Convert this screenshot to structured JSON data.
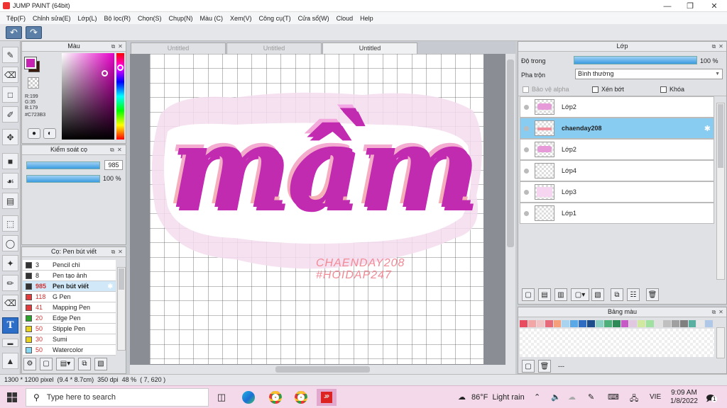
{
  "window": {
    "title": "JUMP PAINT (64bit)",
    "controls": [
      "minimize-icon",
      "maximize-icon",
      "close-icon"
    ]
  },
  "menu": [
    "Tệp(F)",
    "Chỉnh sửa(E)",
    "Lớp(L)",
    "Bộ lọc(R)",
    "Chọn(S)",
    "Chụp(N)",
    "Màu (C)",
    "Xem(V)",
    "Công cụ(T)",
    "Cửa sổ(W)",
    "Cloud",
    "Help"
  ],
  "color_panel": {
    "title": "Màu",
    "r": "R:199",
    "g": "G:35",
    "b": "B:179",
    "hex": "#C723B3",
    "foreground": "#c723b3",
    "background": "#3a1a0a"
  },
  "brush_control": {
    "title": "Kiểm soát cọ",
    "size": "985",
    "opacity": "100 %"
  },
  "brush_list": {
    "title": "Cọ: Pen bút viết",
    "items": [
      {
        "size": "3",
        "name": "Pencil chì",
        "color": "#333333"
      },
      {
        "size": "8",
        "name": "Pen tạo ảnh",
        "color": "#333333"
      },
      {
        "size": "985",
        "name": "Pen bút viết",
        "color": "#333333",
        "selected": true
      },
      {
        "size": "118",
        "name": "G Pen",
        "color": "#e23b3b"
      },
      {
        "size": "41",
        "name": "Mapping Pen",
        "color": "#e23b3b"
      },
      {
        "size": "20",
        "name": "Edge Pen",
        "color": "#2aa52a"
      },
      {
        "size": "50",
        "name": "Stipple Pen",
        "color": "#e8d21c"
      },
      {
        "size": "30",
        "name": "Sumi",
        "color": "#e8d21c"
      },
      {
        "size": "50",
        "name": "Watercolor",
        "color": "#86d8f2"
      }
    ]
  },
  "tabs": [
    "Untitled",
    "Untitled",
    "Untitled"
  ],
  "canvas": {
    "headline": "mầm",
    "watermark_line1": "CHAENDAY208",
    "watermark_line2": "#HOIDAP247"
  },
  "layer_panel": {
    "title": "Lớp",
    "opacity_label": "Độ trong",
    "opacity_value": "100 %",
    "blend_label": "Pha trộn",
    "blend_value": "Bình thường",
    "protect_alpha": "Bảo vệ alpha",
    "clipping": "Xén bớt",
    "lock": "Khóa",
    "layers": [
      {
        "name": "Lớp2",
        "selected": false
      },
      {
        "name": "chaenday208",
        "selected": true
      },
      {
        "name": "Lớp2",
        "selected": false
      },
      {
        "name": "Lớp4",
        "selected": false
      },
      {
        "name": "Lớp3",
        "selected": false
      },
      {
        "name": "Lớp1",
        "selected": false
      }
    ]
  },
  "palette_panel": {
    "title": "Bảng màu",
    "dashes": "---",
    "swatches": [
      "#e84a5f",
      "#f2a6a6",
      "#f0c4c4",
      "#e66a7a",
      "#f5a07a",
      "#a8d4f0",
      "#5aa9e6",
      "#2d6cc0",
      "#1e4d8c",
      "#8ad0c2",
      "#4db07a",
      "#2e8b57",
      "#c85ac8",
      "#e0c8e0",
      "#d0e8a0",
      "#a0e0a0",
      "#e0e0e0",
      "#c0c0c0",
      "#a0a0a0",
      "#808080",
      "#5ab0a0",
      "#e8e8e8",
      "#b0c8e8"
    ]
  },
  "status_bar": {
    "text": "1300 * 1200 pixel  (9.4 * 8.7cm)  350 dpi  48 %  ( 7, 620 )"
  },
  "taskbar": {
    "search_placeholder": "Type here to search",
    "weather": "86°F  Light rain",
    "lang": "VIE",
    "time": "9:09 AM",
    "date": "1/8/2022",
    "notif_count": "1"
  }
}
